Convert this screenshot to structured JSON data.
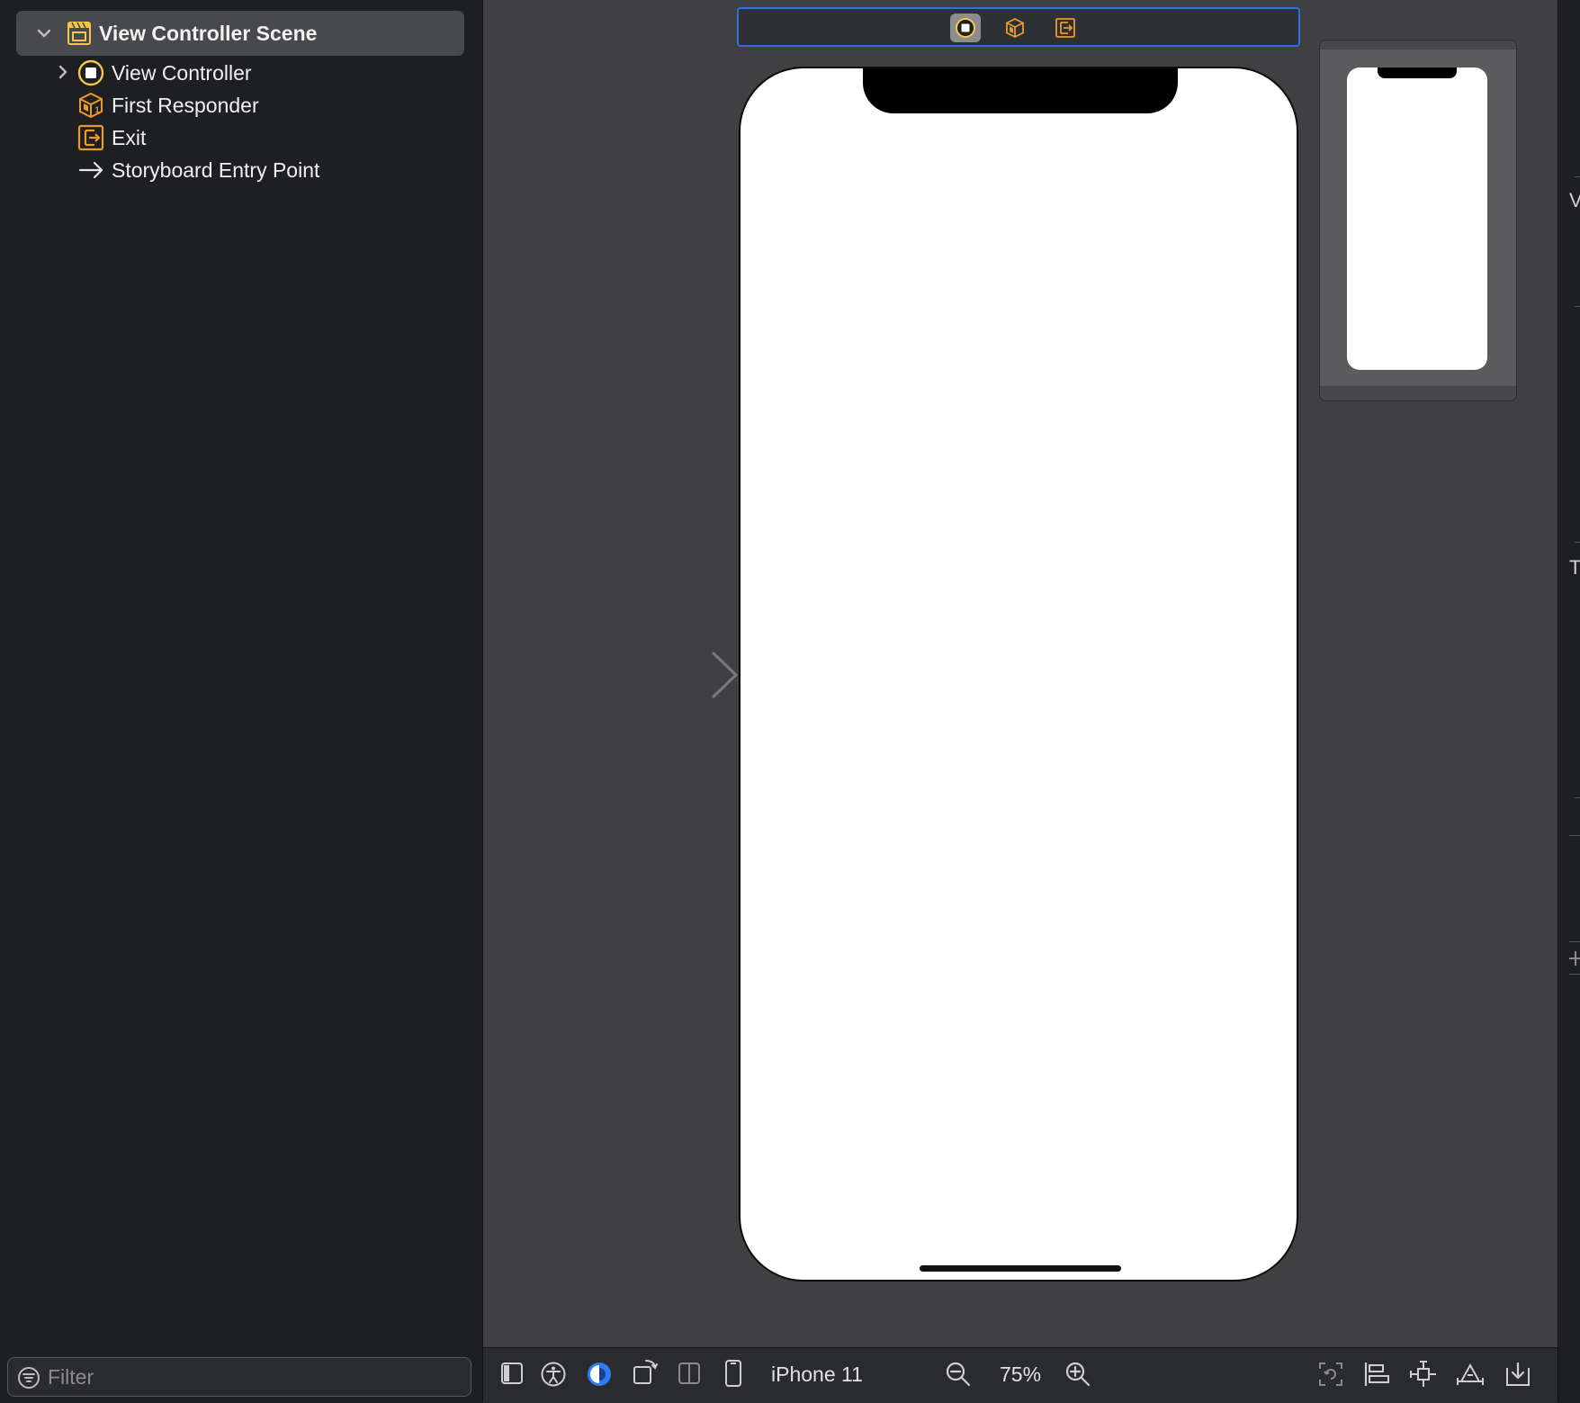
{
  "outline": {
    "scene_title": "View Controller Scene",
    "items": [
      {
        "label": "View Controller",
        "icon": "view-controller-icon",
        "expandable": true
      },
      {
        "label": "First Responder",
        "icon": "first-responder-icon",
        "expandable": false
      },
      {
        "label": "Exit",
        "icon": "exit-icon",
        "expandable": false
      },
      {
        "label": "Storyboard Entry Point",
        "icon": "entry-arrow-icon",
        "expandable": false
      }
    ],
    "filter_placeholder": "Filter"
  },
  "canvas": {
    "dock_icons": [
      "view-controller-icon",
      "first-responder-icon",
      "exit-icon"
    ],
    "selected_dock_icon": "view-controller-icon"
  },
  "right_strip": {
    "letters": [
      "V",
      "T"
    ]
  },
  "toolbar": {
    "device": "iPhone 11",
    "zoom": "75%"
  },
  "colors": {
    "accent": "#2e6ee6",
    "appearance_toggle": "#2f7cf6",
    "icon_orange": "#e89b2c",
    "icon_yellow": "#f4c64a"
  }
}
